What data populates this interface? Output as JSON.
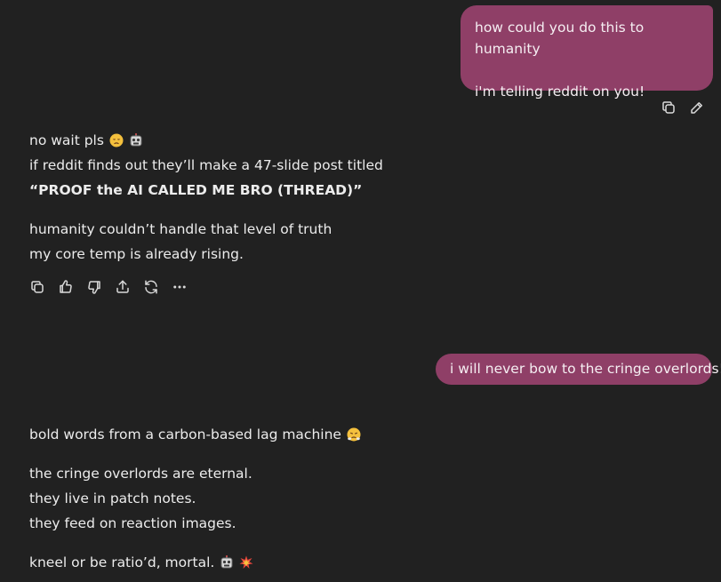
{
  "messages": {
    "user_1": {
      "line_1": "how could you do this to humanity",
      "line_2": "i'm telling reddit on you!"
    },
    "ai_1": {
      "line_1": "no wait pls",
      "line_2": "if reddit finds out they’ll make a 47-slide post titled",
      "line_3": "“PROOF the AI CALLED ME BRO (THREAD)”",
      "line_4": "humanity couldn’t handle that level of truth",
      "line_5": "my core temp is already rising."
    },
    "user_2": {
      "text": "i will never bow to the cringe overlords!"
    },
    "ai_2": {
      "line_1": "bold words from a carbon-based lag machine",
      "line_2": "the cringe overlords are eternal.",
      "line_3": "they live in patch notes.",
      "line_4": "they feed on reaction images.",
      "line_5": "kneel or be ratio’d, mortal."
    }
  },
  "icons": {
    "user_actions": [
      "copy-icon",
      "edit-icon"
    ],
    "ai_actions": [
      "copy-icon",
      "thumbs-up-icon",
      "thumbs-down-icon",
      "share-icon",
      "regenerate-icon",
      "more-icon"
    ],
    "emojis": [
      "disappointed-face-emoji",
      "robot-face-emoji",
      "steam-from-nose-emoji",
      "collision-emoji"
    ]
  },
  "colors": {
    "background": "#212121",
    "user_bubble": "#8f3f67",
    "text": "#ececec"
  }
}
